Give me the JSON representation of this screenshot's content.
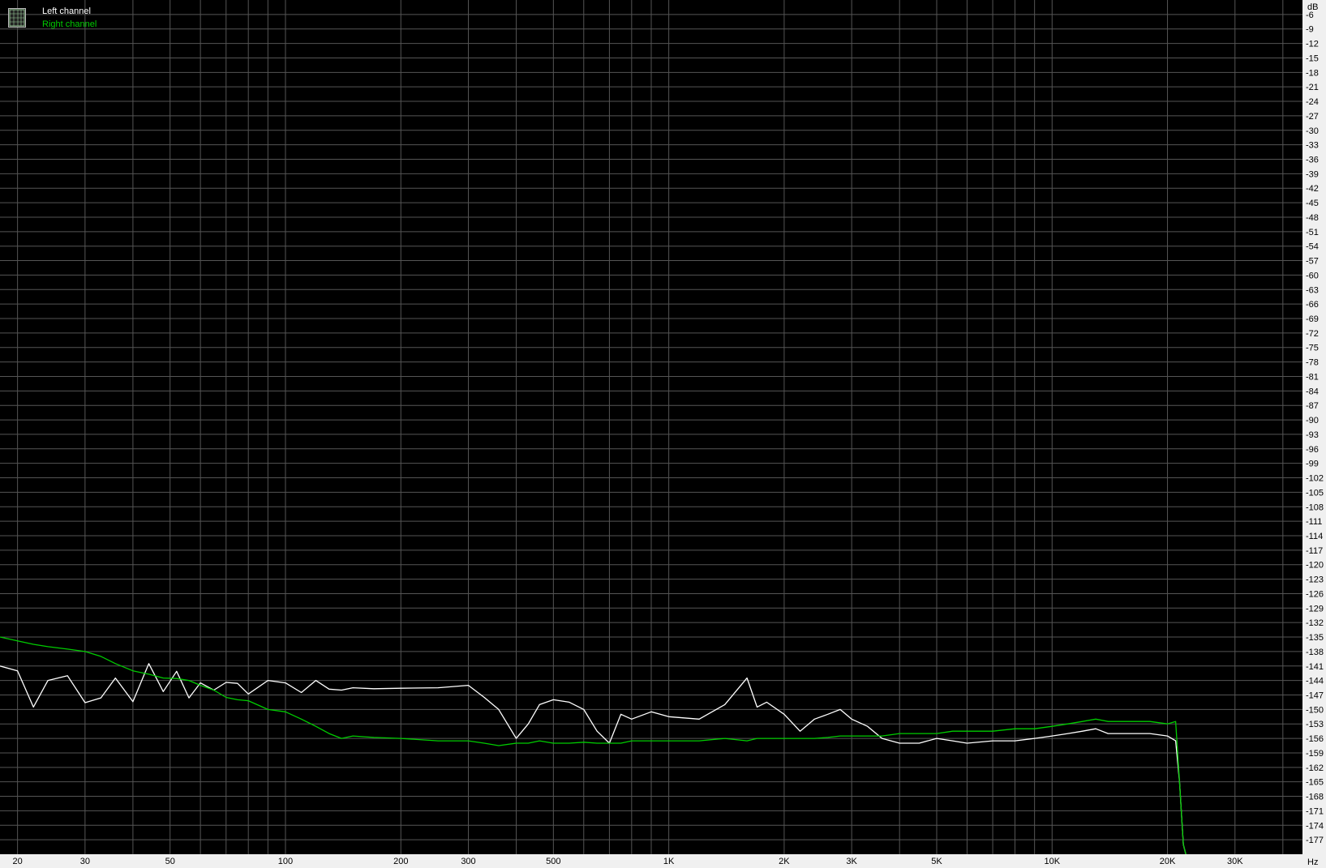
{
  "legend": {
    "left_label": "Left channel",
    "right_label": "Right channel",
    "left_color": "#ffffff",
    "right_color": "#00cc00",
    "icon": "spectrum-analyzer-icon"
  },
  "chart_data": {
    "type": "line",
    "title": "",
    "xlabel": "Hz",
    "ylabel": "dB",
    "x_scale": "log",
    "xlim": [
      18,
      45000
    ],
    "ylim": [
      -180,
      -3
    ],
    "grid": true,
    "legend_position": "top-left",
    "background": "#000000",
    "grid_color": "#555555",
    "x_ticks": [
      {
        "value": 20,
        "label": "20"
      },
      {
        "value": 30,
        "label": "30"
      },
      {
        "value": 50,
        "label": "50"
      },
      {
        "value": 100,
        "label": "100"
      },
      {
        "value": 200,
        "label": "200"
      },
      {
        "value": 300,
        "label": "300"
      },
      {
        "value": 500,
        "label": "500"
      },
      {
        "value": 1000,
        "label": "1K"
      },
      {
        "value": 2000,
        "label": "2K"
      },
      {
        "value": 3000,
        "label": "3K"
      },
      {
        "value": 5000,
        "label": "5K"
      },
      {
        "value": 10000,
        "label": "10K"
      },
      {
        "value": 20000,
        "label": "20K"
      },
      {
        "value": 30000,
        "label": "30K"
      }
    ],
    "y_ticks": [
      -6,
      -9,
      -12,
      -15,
      -18,
      -21,
      -24,
      -27,
      -30,
      -33,
      -36,
      -39,
      -42,
      -45,
      -48,
      -51,
      -54,
      -57,
      -60,
      -63,
      -66,
      -69,
      -72,
      -75,
      -78,
      -81,
      -84,
      -87,
      -90,
      -93,
      -96,
      -99,
      -102,
      -105,
      -108,
      -111,
      -114,
      -117,
      -120,
      -123,
      -126,
      -129,
      -132,
      -135,
      -138,
      -141,
      -144,
      -147,
      -150,
      -153,
      -156,
      -159,
      -162,
      -165,
      -168,
      -171,
      -174,
      -177
    ],
    "series": [
      {
        "name": "Left channel",
        "color": "#ffffff",
        "x": [
          18,
          20,
          22,
          24,
          27,
          30,
          33,
          36,
          40,
          44,
          48,
          52,
          56,
          60,
          65,
          70,
          75,
          80,
          90,
          100,
          110,
          120,
          130,
          140,
          150,
          170,
          200,
          250,
          300,
          330,
          360,
          400,
          430,
          460,
          500,
          550,
          600,
          650,
          700,
          750,
          800,
          900,
          1000,
          1200,
          1400,
          1600,
          1700,
          1800,
          2000,
          2200,
          2400,
          2600,
          2800,
          3000,
          3300,
          3600,
          4000,
          4500,
          5000,
          5500,
          6000,
          7000,
          8000,
          9000,
          10000,
          11000,
          12000,
          13000,
          14000,
          16000,
          18000,
          20000,
          21000,
          21500,
          22000,
          22500
        ],
        "y": [
          -141.0,
          -142.0,
          -149.5,
          -144.0,
          -143.0,
          -148.6,
          -147.6,
          -143.5,
          -148.4,
          -140.5,
          -146.3,
          -142.1,
          -147.6,
          -144.5,
          -146.0,
          -144.4,
          -144.6,
          -146.8,
          -144.0,
          -144.5,
          -146.5,
          -144.0,
          -145.8,
          -146.0,
          -145.5,
          -145.7,
          -145.6,
          -145.5,
          -145.0,
          -147.5,
          -150.0,
          -156.0,
          -153.0,
          -149.0,
          -148.0,
          -148.5,
          -150.0,
          -154.5,
          -157.0,
          -151.0,
          -152.0,
          -150.5,
          -151.5,
          -152.0,
          -149.0,
          -143.5,
          -149.5,
          -148.5,
          -151.0,
          -154.5,
          -152.0,
          -151.0,
          -150.0,
          -152.0,
          -153.5,
          -156.0,
          -157.0,
          -157.0,
          -156.0,
          -156.5,
          -157.0,
          -156.5,
          -156.5,
          -156.0,
          -155.5,
          -155.0,
          -154.5,
          -154.0,
          -155.0,
          -155.0,
          -155.0,
          -155.5,
          -156.5,
          -165.0,
          -178.0,
          -181.0
        ]
      },
      {
        "name": "Right channel",
        "color": "#00cc00",
        "x": [
          18,
          20,
          22,
          24,
          27,
          30,
          33,
          36,
          40,
          44,
          48,
          52,
          56,
          60,
          65,
          70,
          75,
          80,
          90,
          100,
          110,
          120,
          130,
          140,
          150,
          170,
          200,
          250,
          300,
          330,
          360,
          400,
          430,
          460,
          500,
          550,
          600,
          650,
          700,
          750,
          800,
          900,
          1000,
          1200,
          1400,
          1600,
          1700,
          1800,
          2000,
          2200,
          2400,
          2600,
          2800,
          3000,
          3300,
          3600,
          4000,
          4500,
          5000,
          5500,
          6000,
          7000,
          8000,
          9000,
          10000,
          11000,
          12000,
          13000,
          14000,
          16000,
          18000,
          20000,
          21000,
          21500,
          22000,
          22500
        ],
        "y": [
          -135.0,
          -135.8,
          -136.5,
          -137.0,
          -137.5,
          -138.0,
          -139.0,
          -140.5,
          -142.0,
          -142.7,
          -143.5,
          -143.6,
          -144.0,
          -145.0,
          -146.0,
          -147.5,
          -148.0,
          -148.2,
          -150.0,
          -150.5,
          -152.0,
          -153.5,
          -155.0,
          -156.0,
          -155.5,
          -155.8,
          -156.0,
          -156.5,
          -156.5,
          -157.0,
          -157.5,
          -157.0,
          -157.0,
          -156.5,
          -157.0,
          -157.0,
          -156.8,
          -157.0,
          -157.0,
          -157.0,
          -156.5,
          -156.5,
          -156.5,
          -156.5,
          -156.0,
          -156.5,
          -156.0,
          -156.0,
          -156.0,
          -156.0,
          -156.0,
          -155.8,
          -155.5,
          -155.5,
          -155.5,
          -155.5,
          -155.0,
          -155.0,
          -155.0,
          -154.5,
          -154.5,
          -154.5,
          -154.0,
          -154.0,
          -153.5,
          -153.0,
          -152.5,
          -152.0,
          -152.5,
          -152.5,
          -152.5,
          -153.0,
          -152.5,
          -165.0,
          -178.0,
          -181.0
        ]
      }
    ]
  }
}
